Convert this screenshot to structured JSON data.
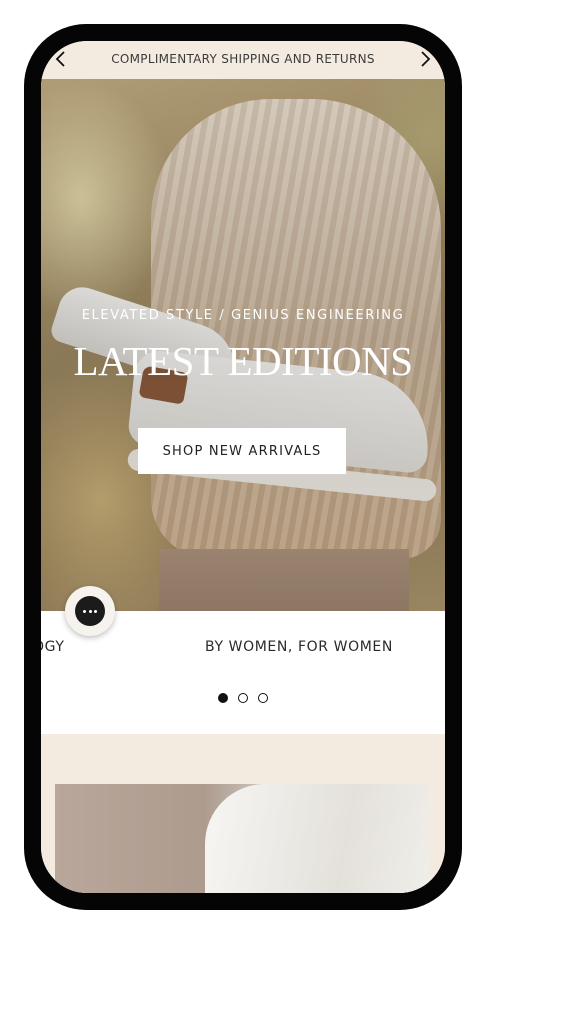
{
  "announcement": {
    "text": "COMPLIMENTARY SHIPPING AND RETURNS",
    "prev_icon": "chevron-left-icon",
    "next_icon": "chevron-right-icon"
  },
  "hero": {
    "eyebrow": "ELEVATED STYLE / GENIUS ENGINEERING",
    "headline": "LATEST EDITIONS",
    "cta_label": "SHOP NEW ARRIVALS"
  },
  "value_props": {
    "items": [
      "OGY",
      "BY WOMEN, FOR WOMEN"
    ],
    "carousel_dots": 3,
    "active_dot": 1
  },
  "chat": {
    "icon": "chat-bubble-icon"
  },
  "colors": {
    "cream": "#f4ebe0",
    "phone_frame": "#050505",
    "text_dark": "#2a2a2a",
    "white": "#ffffff"
  }
}
